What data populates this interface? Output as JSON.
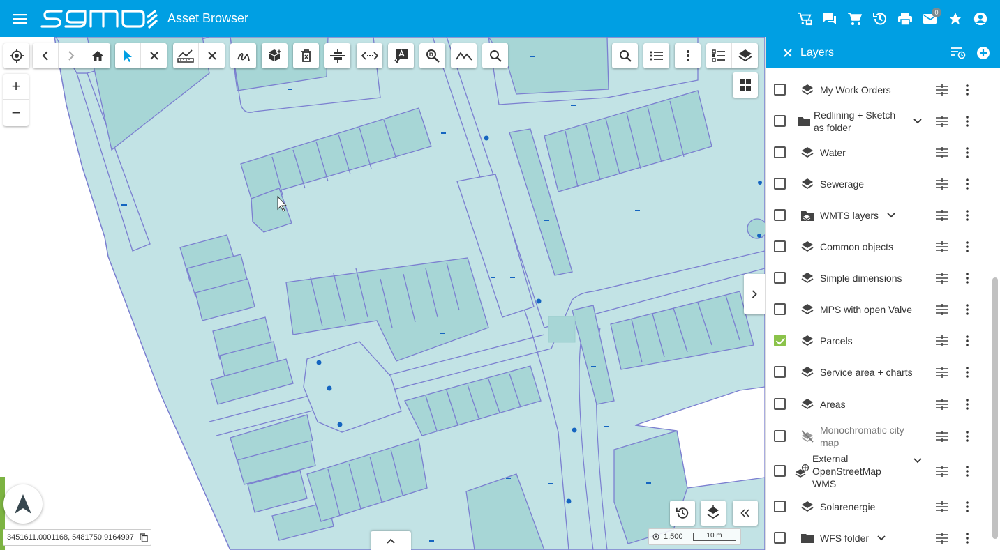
{
  "header": {
    "app_title": "Asset Browser",
    "logo_text": "samo",
    "mail_badge": "0",
    "icons": [
      "menu-icon",
      "logo",
      "cart-list-icon",
      "chat-icon",
      "cart-icon",
      "history-icon",
      "print-icon",
      "mail-icon",
      "star-icon",
      "account-icon"
    ],
    "color": "#009fe3"
  },
  "toolbar": {
    "groups": [
      [
        "locate-icon"
      ],
      [
        "back-icon",
        "forward-icon",
        "home-icon"
      ],
      [
        "select-pointer-icon",
        "clear-selection-icon"
      ],
      [
        "measure-icon",
        "clear-measure-icon"
      ],
      [
        "sketch-icon"
      ],
      [
        "add-3d-object-icon"
      ],
      [
        "delete-icon"
      ],
      [
        "split-icon"
      ],
      [
        "distance-icon"
      ],
      [
        "text-annotation-icon"
      ],
      [
        "zoom-search-icon"
      ],
      [
        "profile-icon"
      ],
      [
        "search-icon"
      ]
    ],
    "right_groups": [
      [
        "search-icon"
      ],
      [
        "list-icon"
      ],
      [
        "more-icon"
      ],
      [
        "legend-icon",
        "layers-icon"
      ]
    ]
  },
  "map": {
    "zoom_in": "+",
    "zoom_out": "−",
    "coordinates": "3451611.0001168, 5481750.9164997",
    "scale": "1:500",
    "scale_bar_label": "10 m",
    "colors": {
      "parcel_fill": "#c2e3e5",
      "building_fill": "#a7d6d6",
      "outline": "#7b7fd0",
      "marker": "#1565c0"
    }
  },
  "layers_panel": {
    "title": "Layers",
    "items": [
      {
        "label": "My Work Orders",
        "checked": false,
        "icon": "layer-icon",
        "expandable": false
      },
      {
        "label": "Redlining + Sketch as folder",
        "checked": false,
        "icon": "folder-icon",
        "expandable": true
      },
      {
        "label": "Water",
        "checked": false,
        "icon": "layer-icon",
        "expandable": false
      },
      {
        "label": "Sewerage",
        "checked": false,
        "icon": "layer-icon",
        "expandable": false
      },
      {
        "label": "WMTS layers",
        "checked": false,
        "icon": "wmts-folder-icon",
        "expandable": true
      },
      {
        "label": "Common objects",
        "checked": false,
        "icon": "layer-icon",
        "expandable": false
      },
      {
        "label": "Simple dimensions",
        "checked": false,
        "icon": "layer-icon",
        "expandable": false
      },
      {
        "label": "MPS with open Valve",
        "checked": false,
        "icon": "layer-icon",
        "expandable": false
      },
      {
        "label": "Parcels",
        "checked": true,
        "icon": "layer-icon",
        "expandable": false
      },
      {
        "label": "Service area + charts",
        "checked": false,
        "icon": "layer-icon",
        "expandable": false
      },
      {
        "label": "Areas",
        "checked": false,
        "icon": "layer-icon",
        "expandable": false
      },
      {
        "label": "Monochromatic city map",
        "checked": false,
        "icon": "hidden-layer-icon",
        "expandable": false
      },
      {
        "label": "External OpenStreetMap WMS",
        "checked": false,
        "icon": "wms-layer-icon",
        "expandable": true
      },
      {
        "label": "Solarenergie",
        "checked": false,
        "icon": "layer-icon",
        "expandable": false
      },
      {
        "label": "WFS folder",
        "checked": false,
        "icon": "folder-icon",
        "expandable": true
      }
    ]
  }
}
